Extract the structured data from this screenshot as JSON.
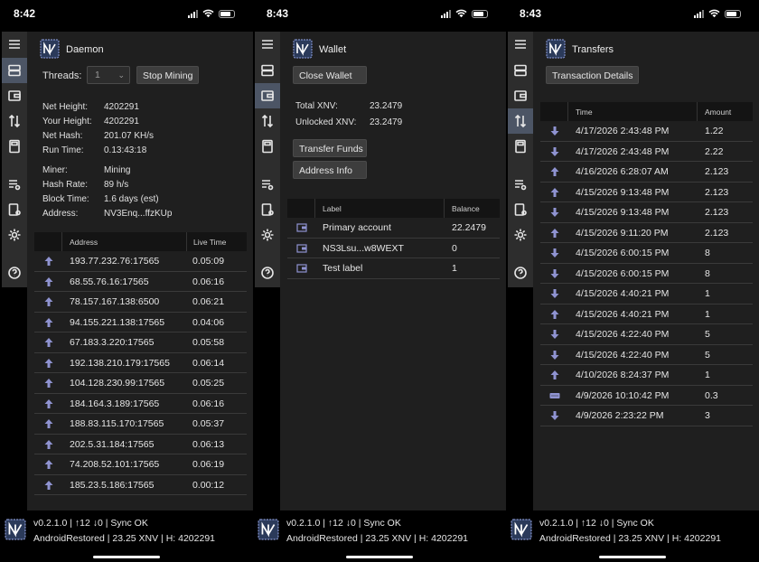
{
  "colors": {
    "accent_arrow": "#8f93d1",
    "active_sidebar": "#4c5565",
    "panel_bg": "#1f1f1f"
  },
  "sidebar_icons": [
    "menu-icon",
    "server-icon",
    "wallet-icon",
    "transfer-arrows-icon",
    "calculator-icon",
    "settings-list-icon",
    "sign-icon",
    "gear-icon",
    "help-icon"
  ],
  "footer": {
    "version_line": "v0.2.1.0 | ↑12 ↓0 | Sync OK",
    "status_line": "AndroidRestored | 23.25 XNV | H: 4202291"
  },
  "daemon": {
    "time": "8:42",
    "title": "Daemon",
    "threads_label": "Threads:",
    "threads_value": "1",
    "stop_mining": "Stop Mining",
    "net_height_label": "Net Height:",
    "net_height": "4202291",
    "your_height_label": "Your Height:",
    "your_height": "4202291",
    "net_hash_label": "Net Hash:",
    "net_hash": "201.07 KH/s",
    "run_time_label": "Run Time:",
    "run_time": "0.13:43:18",
    "miner_label": "Miner:",
    "miner": "Mining",
    "hash_rate_label": "Hash Rate:",
    "hash_rate": "89 h/s",
    "block_time_label": "Block Time:",
    "block_time": "1.6 days (est)",
    "address_label": "Address:",
    "address": "NV3Enq...ffzKUp",
    "col_address": "Address",
    "col_live": "Live Time",
    "peers": [
      {
        "address": "193.77.232.76:17565",
        "live": "0.05:09"
      },
      {
        "address": "68.55.76.16:17565",
        "live": "0.06:16"
      },
      {
        "address": "78.157.167.138:6500",
        "live": "0.06:21"
      },
      {
        "address": "94.155.221.138:17565",
        "live": "0.04:06"
      },
      {
        "address": "67.183.3.220:17565",
        "live": "0.05:58"
      },
      {
        "address": "192.138.210.179:17565",
        "live": "0.06:14"
      },
      {
        "address": "104.128.230.99:17565",
        "live": "0.05:25"
      },
      {
        "address": "184.164.3.189:17565",
        "live": "0.06:16"
      },
      {
        "address": "188.83.115.170:17565",
        "live": "0.05:37"
      },
      {
        "address": "202.5.31.184:17565",
        "live": "0.06:13"
      },
      {
        "address": "74.208.52.101:17565",
        "live": "0.06:19"
      },
      {
        "address": "185.23.5.186:17565",
        "live": "0.00:12"
      }
    ]
  },
  "wallet": {
    "time": "8:43",
    "title": "Wallet",
    "close_wallet": "Close Wallet",
    "total_label": "Total XNV:",
    "total": "23.2479",
    "unlocked_label": "Unlocked XNV:",
    "unlocked": "23.2479",
    "transfer_funds": "Transfer Funds",
    "address_info": "Address Info",
    "col_label": "Label",
    "col_balance": "Balance",
    "accounts": [
      {
        "label": "Primary account",
        "balance": "22.2479"
      },
      {
        "label": "NS3Lsu...w8WEXT",
        "balance": "0"
      },
      {
        "label": "Test label",
        "balance": "1"
      }
    ]
  },
  "transfers": {
    "time": "8:43",
    "title": "Transfers",
    "details_button": "Transaction Details",
    "col_time": "Time",
    "col_amount": "Amount",
    "rows": [
      {
        "dir": "in",
        "time": "4/17/2026 2:43:48 PM",
        "amount": "1.22"
      },
      {
        "dir": "in",
        "time": "4/17/2026 2:43:48 PM",
        "amount": "2.22"
      },
      {
        "dir": "out",
        "time": "4/16/2026 6:28:07 AM",
        "amount": "2.123"
      },
      {
        "dir": "out",
        "time": "4/15/2026 9:13:48 PM",
        "amount": "2.123"
      },
      {
        "dir": "in",
        "time": "4/15/2026 9:13:48 PM",
        "amount": "2.123"
      },
      {
        "dir": "out",
        "time": "4/15/2026 9:11:20 PM",
        "amount": "2.123"
      },
      {
        "dir": "in",
        "time": "4/15/2026 6:00:15 PM",
        "amount": "8"
      },
      {
        "dir": "in",
        "time": "4/15/2026 6:00:15 PM",
        "amount": "8"
      },
      {
        "dir": "in",
        "time": "4/15/2026 4:40:21 PM",
        "amount": "1"
      },
      {
        "dir": "out",
        "time": "4/15/2026 4:40:21 PM",
        "amount": "1"
      },
      {
        "dir": "in",
        "time": "4/15/2026 4:22:40 PM",
        "amount": "5"
      },
      {
        "dir": "in",
        "time": "4/15/2026 4:22:40 PM",
        "amount": "5"
      },
      {
        "dir": "out",
        "time": "4/10/2026 8:24:37 PM",
        "amount": "1"
      },
      {
        "dir": "mined",
        "time": "4/9/2026 10:10:42 PM",
        "amount": "0.3"
      },
      {
        "dir": "in",
        "time": "4/9/2026 2:23:22 PM",
        "amount": "3"
      }
    ]
  }
}
